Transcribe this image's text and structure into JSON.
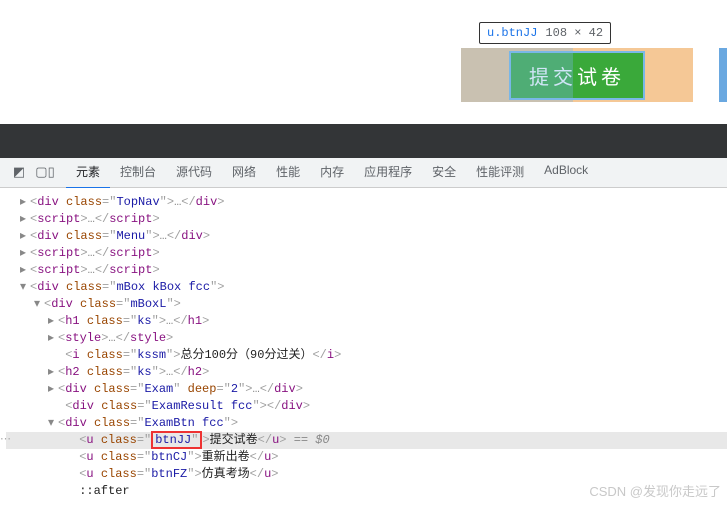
{
  "tooltip": {
    "selector": "u.btnJJ",
    "dimensions": "108 × 42"
  },
  "page": {
    "submit_button": "提交试卷"
  },
  "devtools_tabs": [
    "元素",
    "控制台",
    "源代码",
    "网络",
    "性能",
    "内存",
    "应用程序",
    "安全",
    "性能评测",
    "AdBlock"
  ],
  "dom": {
    "l0": {
      "tag": "div",
      "cls": "TopNav"
    },
    "l1": {
      "tag": "script"
    },
    "l2": {
      "tag": "div",
      "cls": "Menu"
    },
    "l3": {
      "tag": "script"
    },
    "l4": {
      "tag": "script"
    },
    "l5": {
      "tag": "div",
      "cls": "mBox kBox fcc"
    },
    "l6": {
      "tag": "div",
      "cls": "mBoxL"
    },
    "l7": {
      "tag": "h1",
      "cls": "ks"
    },
    "l8": {
      "tag": "style"
    },
    "l9": {
      "tag": "i",
      "cls": "kssm",
      "text": "总分100分（90分过关）"
    },
    "l10": {
      "tag": "h2",
      "cls": "ks"
    },
    "l11": {
      "tag": "div",
      "cls": "Exam",
      "extra_attr": "deep",
      "extra_val": "2"
    },
    "l12": {
      "tag": "div",
      "cls": "ExamResult fcc"
    },
    "l13": {
      "tag": "div",
      "cls": "ExamBtn fcc"
    },
    "l14": {
      "tag": "u",
      "cls": "btnJJ",
      "text": "提交试卷",
      "sel": "== $0"
    },
    "l15": {
      "tag": "u",
      "cls": "btnCJ",
      "text": "重新出卷"
    },
    "l16": {
      "tag": "u",
      "cls": "btnFZ",
      "text": "仿真考场"
    },
    "after": "::after"
  },
  "watermark": "CSDN @发现你走远了"
}
